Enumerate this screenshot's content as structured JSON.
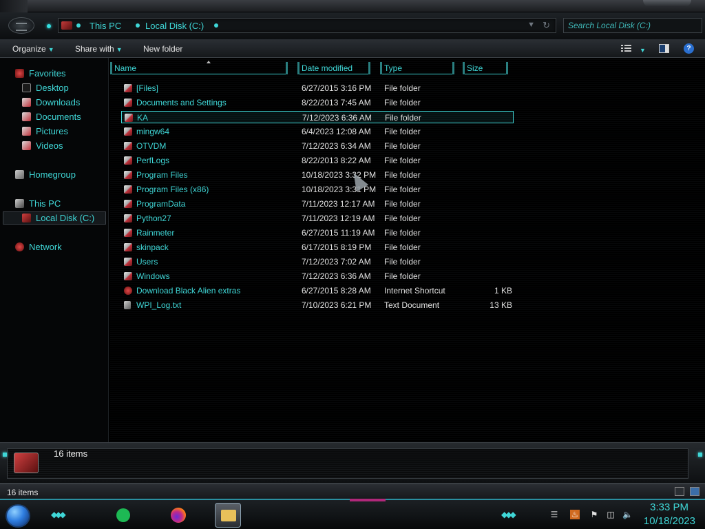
{
  "address": {
    "crumbs": [
      "This PC",
      "Local Disk (C:)"
    ],
    "search_placeholder": "Search Local Disk (C:)"
  },
  "toolbar": {
    "organize": "Organize",
    "share_with": "Share with",
    "new_folder": "New folder"
  },
  "nav": {
    "favorites": "Favorites",
    "desktop": "Desktop",
    "downloads": "Downloads",
    "documents": "Documents",
    "pictures": "Pictures",
    "videos": "Videos",
    "homegroup": "Homegroup",
    "this_pc": "This PC",
    "local_disk": "Local Disk (C:)",
    "network": "Network"
  },
  "columns": {
    "name": "Name",
    "date_modified": "Date modified",
    "type": "Type",
    "size": "Size"
  },
  "files": [
    {
      "name": "[Files]",
      "date": "6/27/2015 3:16 PM",
      "type": "File folder",
      "size": ""
    },
    {
      "name": "Documents and Settings",
      "date": "8/22/2013 7:45 AM",
      "type": "File folder",
      "size": ""
    },
    {
      "name": "KA",
      "date": "7/12/2023 6:36 AM",
      "type": "File folder",
      "size": ""
    },
    {
      "name": "mingw64",
      "date": "6/4/2023 12:08 AM",
      "type": "File folder",
      "size": ""
    },
    {
      "name": "OTVDM",
      "date": "7/12/2023 6:34 AM",
      "type": "File folder",
      "size": ""
    },
    {
      "name": "PerfLogs",
      "date": "8/22/2013 8:22 AM",
      "type": "File folder",
      "size": ""
    },
    {
      "name": "Program Files",
      "date": "10/18/2023 3:32 PM",
      "type": "File folder",
      "size": ""
    },
    {
      "name": "Program Files (x86)",
      "date": "10/18/2023 3:31 PM",
      "type": "File folder",
      "size": ""
    },
    {
      "name": "ProgramData",
      "date": "7/11/2023 12:17 AM",
      "type": "File folder",
      "size": ""
    },
    {
      "name": "Python27",
      "date": "7/11/2023 12:19 AM",
      "type": "File folder",
      "size": ""
    },
    {
      "name": "Rainmeter",
      "date": "6/27/2015 11:19 AM",
      "type": "File folder",
      "size": ""
    },
    {
      "name": "skinpack",
      "date": "6/17/2015 8:19 PM",
      "type": "File folder",
      "size": ""
    },
    {
      "name": "Users",
      "date": "7/12/2023 7:02 AM",
      "type": "File folder",
      "size": ""
    },
    {
      "name": "Windows",
      "date": "7/12/2023 6:36 AM",
      "type": "File folder",
      "size": ""
    },
    {
      "name": "Download Black Alien extras",
      "date": "6/27/2015 8:28 AM",
      "type": "Internet Shortcut",
      "size": "1 KB"
    },
    {
      "name": "WPI_Log.txt",
      "date": "7/10/2023 6:21 PM",
      "type": "Text Document",
      "size": "13 KB"
    }
  ],
  "details": {
    "count": "16 items"
  },
  "status": {
    "count": "16 items"
  },
  "clock": {
    "time": "3:33 PM",
    "date": "10/18/2023"
  },
  "colors": {
    "accent": "#3fd6d6",
    "background": "#000000"
  }
}
